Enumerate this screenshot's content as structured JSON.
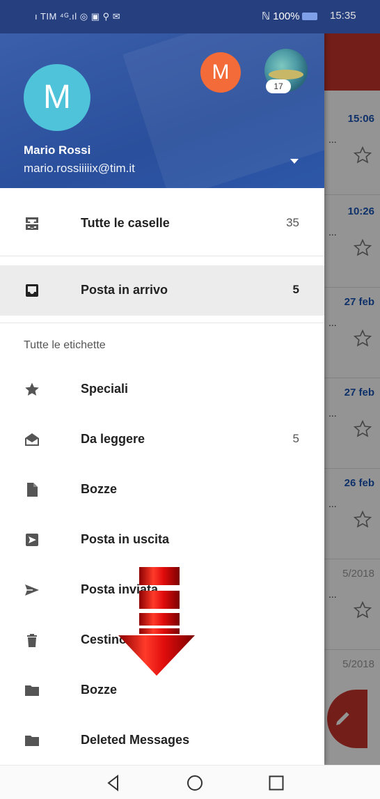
{
  "status_bar": {
    "left_text": "ı TIM ⁴ᴳ.ıl ◎ ▣ ⚲ ✉",
    "right_text": "ℕ 100%",
    "time": "15:35"
  },
  "account": {
    "avatar_letter": "M",
    "secondary_avatar_letter": "M",
    "photo_badge": "17",
    "name": "Mario Rossi",
    "email": "mario.rossiiiiix@tim.it",
    "header_color": "#2a4f9c"
  },
  "drawer": {
    "top_items": [
      {
        "label": "Tutte le caselle",
        "count": "35",
        "icon": "all-inboxes-icon"
      },
      {
        "label": "Posta in arrivo",
        "count": "5",
        "icon": "inbox-icon",
        "selected": true
      }
    ],
    "labels_header": "Tutte le etichette",
    "labels": [
      {
        "label": "Speciali",
        "count": "",
        "icon": "star-icon"
      },
      {
        "label": "Da leggere",
        "count": "5",
        "icon": "open-envelope-icon"
      },
      {
        "label": "Bozze",
        "count": "",
        "icon": "draft-icon"
      },
      {
        "label": "Posta in uscita",
        "count": "",
        "icon": "outbox-icon"
      },
      {
        "label": "Posta inviata",
        "count": "",
        "icon": "send-icon"
      },
      {
        "label": "Cestino",
        "count": "",
        "icon": "trash-icon"
      },
      {
        "label": "Bozze",
        "count": "",
        "icon": "folder-icon"
      },
      {
        "label": "Deleted Messages",
        "count": "",
        "icon": "folder-icon"
      }
    ]
  },
  "background_list": {
    "times": [
      "15:06",
      "10:26",
      "27 feb",
      "27 feb",
      "26 feb",
      "5/2018",
      "5/2018"
    ],
    "snippet": "..."
  },
  "colors": {
    "accent_red": "#c7342c",
    "unread_blue": "#1a55b5"
  }
}
